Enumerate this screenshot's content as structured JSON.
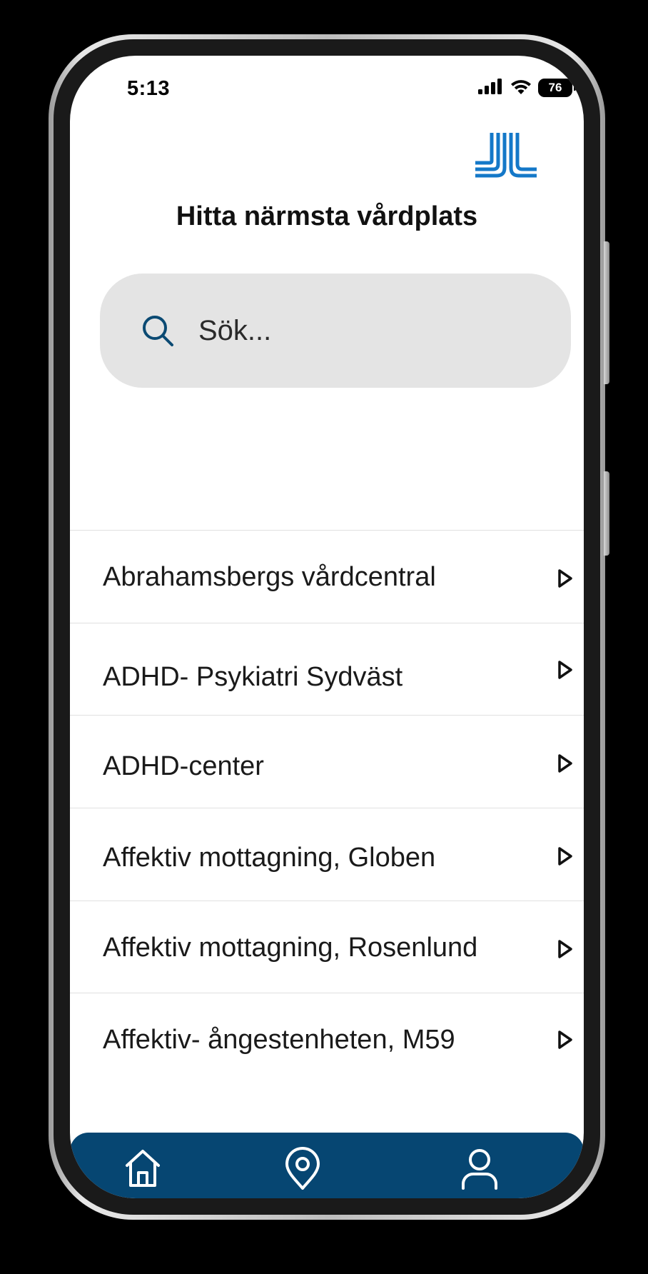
{
  "status_bar": {
    "time": "5:13",
    "battery": "76",
    "icons": [
      "cellular-signal-icon",
      "wifi-icon",
      "battery-icon"
    ]
  },
  "header": {
    "logo": "region-stockholm-logo",
    "title": "Hitta närmsta vårdplats"
  },
  "search": {
    "placeholder": "Sök...",
    "value": "",
    "icon": "search-icon"
  },
  "list": {
    "items": [
      {
        "label": "Abrahamsbergs vårdcentral",
        "icon": "play-arrow-icon"
      },
      {
        "label": "ADHD- Psykiatri Sydväst",
        "icon": "play-arrow-icon"
      },
      {
        "label": "ADHD-center",
        "icon": "play-arrow-icon"
      },
      {
        "label": "Affektiv mottagning, Globen",
        "icon": "play-arrow-icon"
      },
      {
        "label": "Affektiv mottagning, Rosenlund",
        "icon": "play-arrow-icon"
      },
      {
        "label": "Affektiv- ångestenheten, M59",
        "icon": "play-arrow-icon"
      }
    ]
  },
  "bottom_nav": {
    "items": [
      "home-icon",
      "location-pin-icon",
      "user-profile-icon"
    ]
  },
  "colors": {
    "accent": "#064672",
    "logo_blue": "#1478c8",
    "search_bg": "#e4e4e4",
    "divider": "#e0e0e0"
  }
}
